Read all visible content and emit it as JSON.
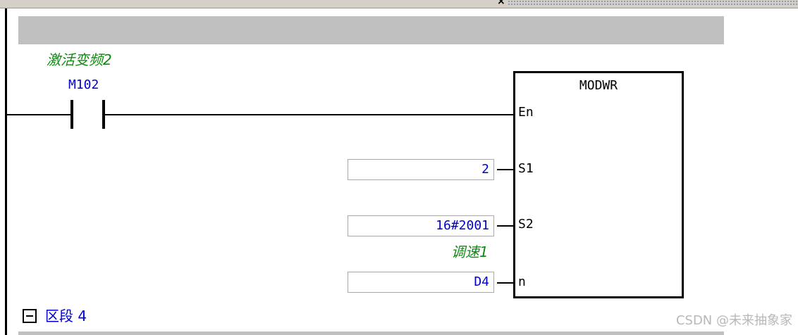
{
  "rung": {
    "comment": "激活变频2",
    "contact_operand": "M102"
  },
  "block": {
    "name": "MODWR",
    "pins": {
      "en": "En",
      "s1": "S1",
      "s2": "S2",
      "n": "n"
    },
    "inputs": {
      "s1_value": "2",
      "s2_value": "16#2001",
      "s2_comment": "调速1",
      "n_value": "D4"
    }
  },
  "section": {
    "label": "区段 4"
  },
  "watermark": "CSDN @未来抽象家",
  "colors": {
    "operand": "#0000cc",
    "comment": "#118a11",
    "header_band": "#c0c0c0"
  }
}
